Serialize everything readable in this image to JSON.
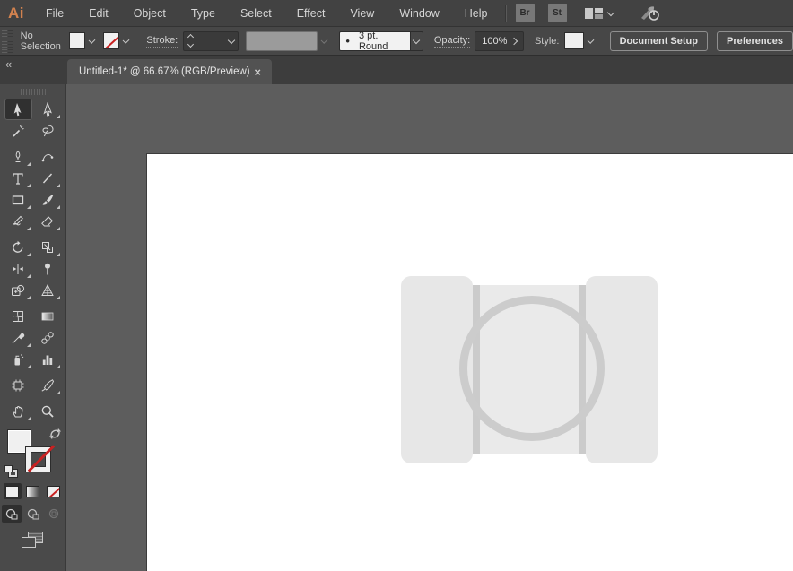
{
  "app": {
    "logo_text": "Ai",
    "logo_color": "#d2824f"
  },
  "menubar": {
    "items": [
      "File",
      "Edit",
      "Object",
      "Type",
      "Select",
      "Effect",
      "View",
      "Window",
      "Help"
    ],
    "bridge_button": "Br",
    "stock_button": "St"
  },
  "control_bar": {
    "selection_status": "No Selection",
    "stroke_label": "Stroke:",
    "brush_bullet": "•",
    "brush_name": "3 pt. Round",
    "opacity_label": "Opacity:",
    "opacity_value": "100%",
    "style_label": "Style:",
    "document_setup_label": "Document Setup",
    "preferences_label": "Preferences"
  },
  "document_tab": {
    "title": "Untitled-1* @ 66.67% (RGB/Preview)",
    "close_glyph": "×"
  },
  "toolbar": {
    "collapse_glyph": "«",
    "tools": [
      {
        "name": "selection-tool",
        "selected": true,
        "flyout": false,
        "group_start": false
      },
      {
        "name": "direct-selection-tool",
        "flyout": true,
        "group_start": false
      },
      {
        "name": "magic-wand-tool",
        "flyout": false,
        "group_start": false
      },
      {
        "name": "lasso-tool",
        "flyout": false,
        "group_start": false
      },
      {
        "name": "pen-tool",
        "flyout": true,
        "group_start": true
      },
      {
        "name": "curvature-tool",
        "flyout": false,
        "group_start": false
      },
      {
        "name": "type-tool",
        "flyout": true,
        "group_start": false
      },
      {
        "name": "line-segment-tool",
        "flyout": true,
        "group_start": false
      },
      {
        "name": "rectangle-tool",
        "flyout": true,
        "group_start": false
      },
      {
        "name": "paintbrush-tool",
        "flyout": true,
        "group_start": false
      },
      {
        "name": "shaper-tool",
        "flyout": true,
        "group_start": false
      },
      {
        "name": "eraser-tool",
        "flyout": true,
        "group_start": false
      },
      {
        "name": "rotate-tool",
        "flyout": true,
        "group_start": true
      },
      {
        "name": "scale-tool",
        "flyout": true,
        "group_start": false
      },
      {
        "name": "width-tool",
        "flyout": true,
        "group_start": false
      },
      {
        "name": "puppet-warp-tool",
        "flyout": false,
        "group_start": false
      },
      {
        "name": "shape-builder-tool",
        "flyout": true,
        "group_start": false
      },
      {
        "name": "perspective-grid-tool",
        "flyout": true,
        "group_start": false
      },
      {
        "name": "mesh-tool",
        "flyout": false,
        "group_start": true
      },
      {
        "name": "gradient-tool",
        "flyout": false,
        "group_start": false
      },
      {
        "name": "eyedropper-tool",
        "flyout": true,
        "group_start": false
      },
      {
        "name": "blend-tool",
        "flyout": false,
        "group_start": false
      },
      {
        "name": "symbol-sprayer-tool",
        "flyout": true,
        "group_start": false
      },
      {
        "name": "column-graph-tool",
        "flyout": true,
        "group_start": false
      },
      {
        "name": "artboard-tool",
        "flyout": false,
        "group_start": true
      },
      {
        "name": "slice-tool",
        "flyout": true,
        "group_start": false
      },
      {
        "name": "hand-tool",
        "flyout": true,
        "group_start": true
      },
      {
        "name": "zoom-tool",
        "flyout": false,
        "group_start": false
      }
    ]
  },
  "appearance_controls": {
    "fill_color": "#f0f0f0",
    "stroke_value": "none",
    "none_slash_color": "#c92121"
  },
  "canvas": {
    "pasteboard_color": "#5d5d5d",
    "artboard_color": "#ffffff",
    "placeholder": {
      "panel_fill": "#e7e7e7",
      "center_fill": "#eaeaea",
      "ring_color": "#cccccc",
      "strip_color": "#cbcbcb"
    }
  }
}
